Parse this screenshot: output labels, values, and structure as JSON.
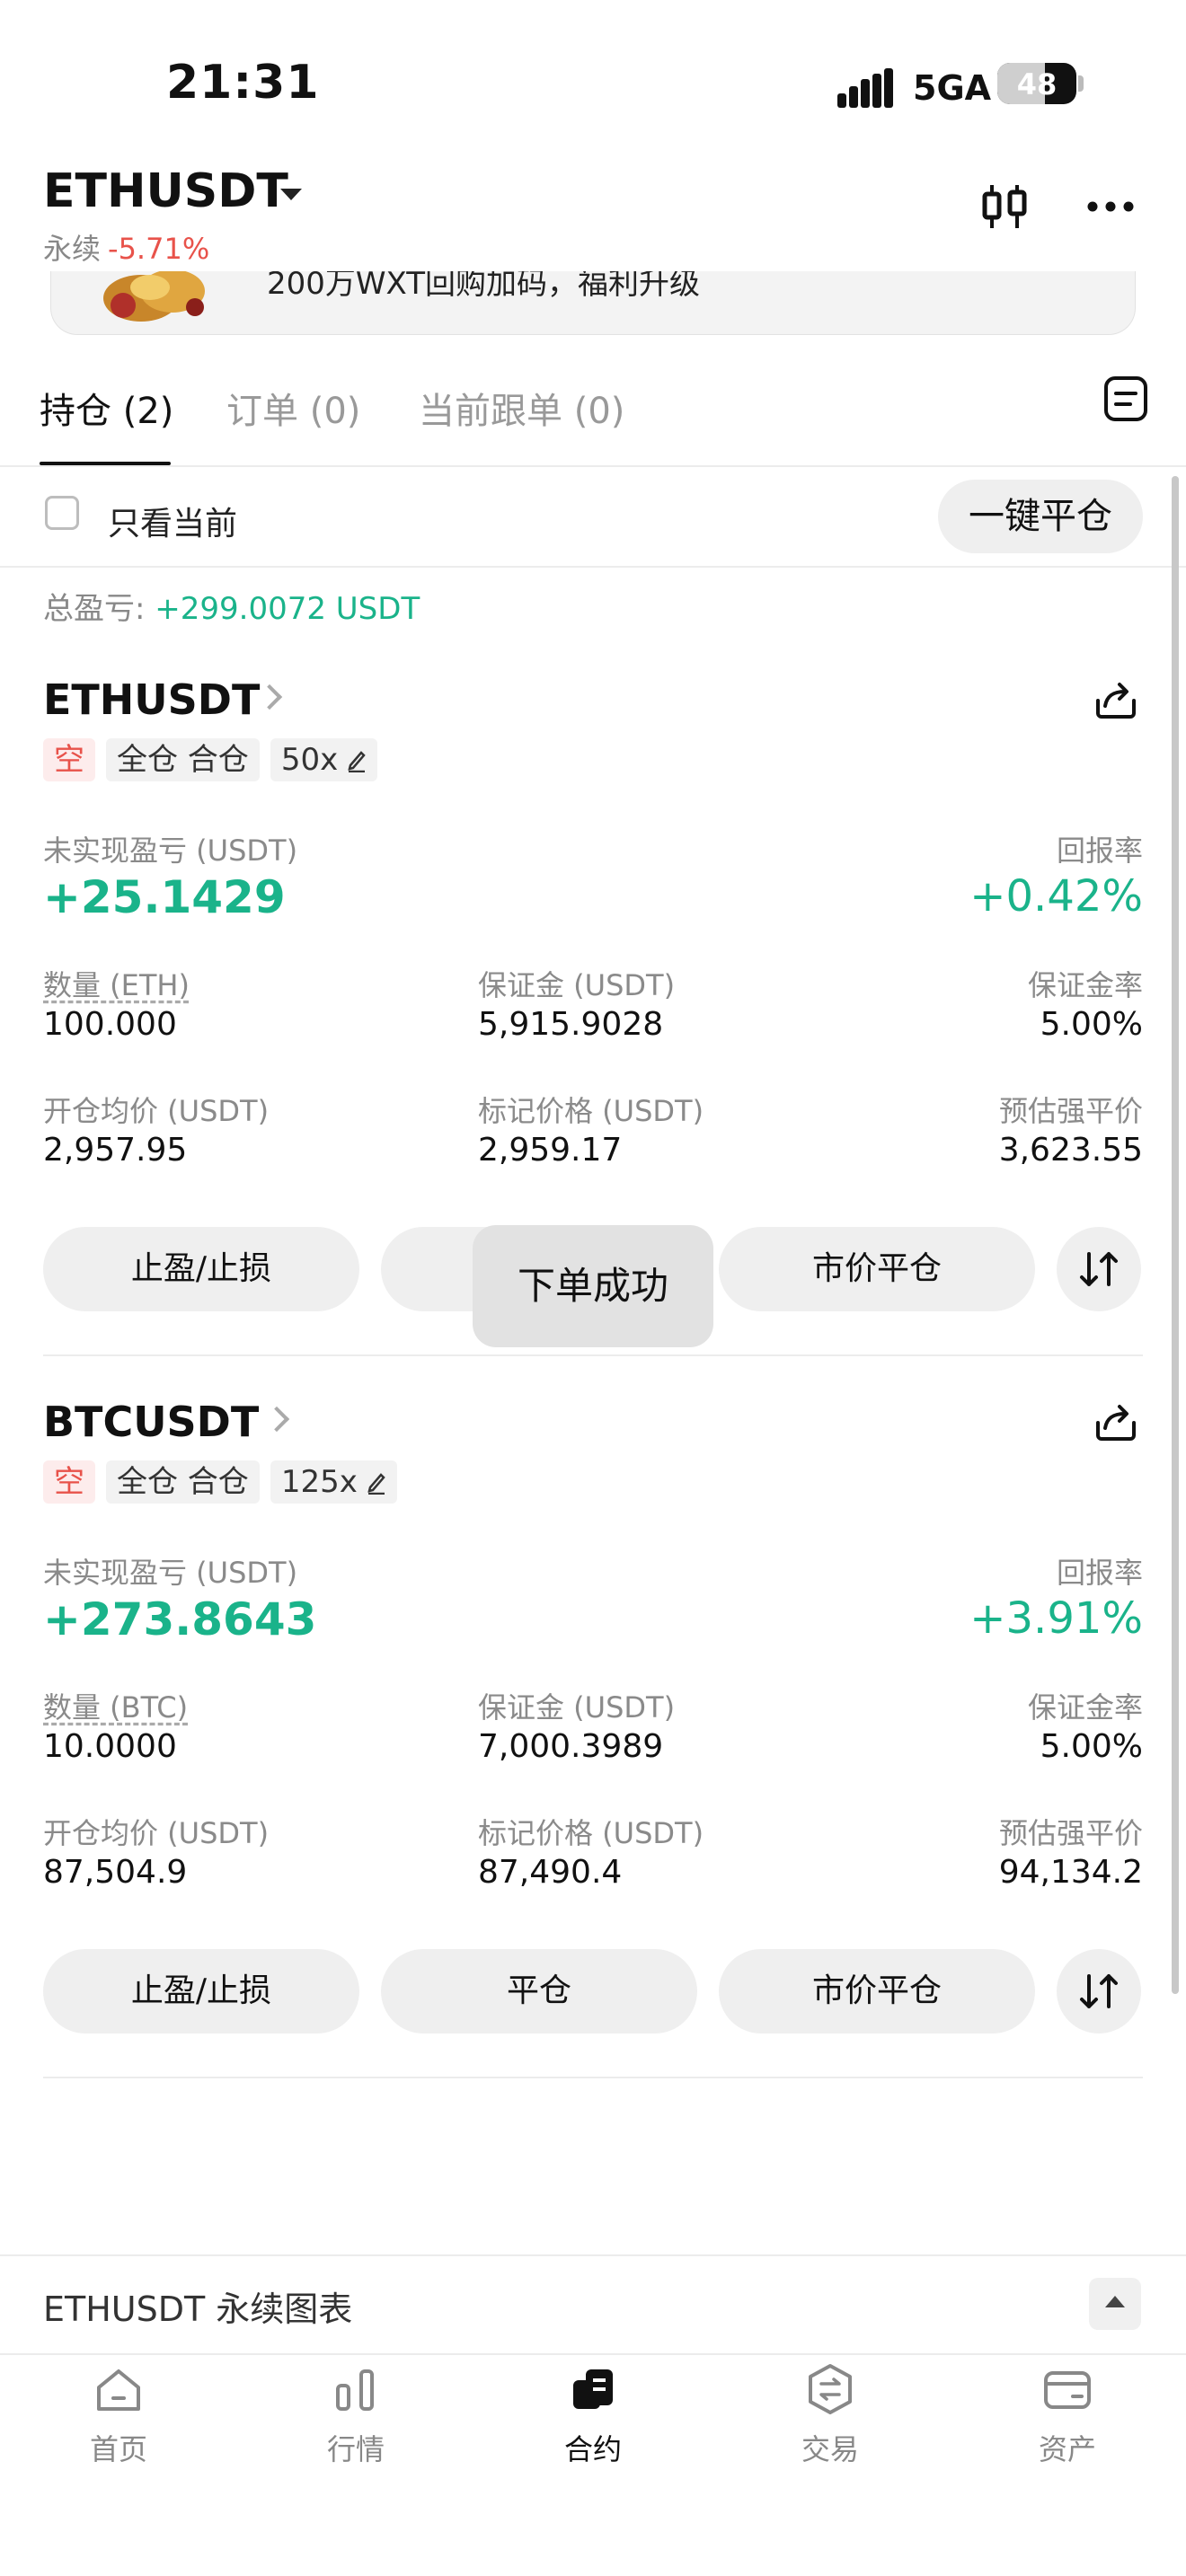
{
  "status_bar": {
    "time": "21:31",
    "network": "5GA",
    "battery": "48"
  },
  "header": {
    "symbol": "ETHUSDT",
    "contract_type": "永续",
    "change": "-5.71%"
  },
  "banner": {
    "text": "200万WXT回购加码，福利升级"
  },
  "tabs": [
    {
      "label": "持仓 (2)",
      "active": true
    },
    {
      "label": "订单 (0)",
      "active": false
    },
    {
      "label": "当前跟单 (0)",
      "active": false
    }
  ],
  "filter": {
    "only_current_label": "只看当前",
    "only_current_checked": false,
    "close_all_label": "一键平仓"
  },
  "summary": {
    "total_pnl_label": "总盈亏: ",
    "total_pnl_value": "+299.0072 USDT"
  },
  "positions": [
    {
      "symbol": "ETHUSDT",
      "side": "空",
      "margin_mode": "全仓 合仓",
      "leverage": "50x",
      "pnl_label": "未实现盈亏 (USDT)",
      "pnl_value": "+25.1429",
      "roe_label": "回报率",
      "roe_value": "+0.42%",
      "qty_label": "数量 (ETH)",
      "qty_value": "100.000",
      "margin_label": "保证金 (USDT)",
      "margin_value": "5,915.9028",
      "margin_ratio_label": "保证金率",
      "margin_ratio_value": "5.00%",
      "entry_label": "开仓均价 (USDT)",
      "entry_value": "2,957.95",
      "mark_label": "标记价格 (USDT)",
      "mark_value": "2,959.17",
      "liq_label": "预估强平价",
      "liq_value": "3,623.55",
      "btn_tpsl": "止盈/止损",
      "btn_close": "平仓",
      "btn_market_close": "市价平仓"
    },
    {
      "symbol": "BTCUSDT",
      "side": "空",
      "margin_mode": "全仓 合仓",
      "leverage": "125x",
      "pnl_label": "未实现盈亏 (USDT)",
      "pnl_value": "+273.8643",
      "roe_label": "回报率",
      "roe_value": "+3.91%",
      "qty_label": "数量 (BTC)",
      "qty_value": "10.0000",
      "margin_label": "保证金 (USDT)",
      "margin_value": "7,000.3989",
      "margin_ratio_label": "保证金率",
      "margin_ratio_value": "5.00%",
      "entry_label": "开仓均价 (USDT)",
      "entry_value": "87,504.9",
      "mark_label": "标记价格 (USDT)",
      "mark_value": "87,490.4",
      "liq_label": "预估强平价",
      "liq_value": "94,134.2",
      "btn_tpsl": "止盈/止损",
      "btn_close": "平仓",
      "btn_market_close": "市价平仓"
    }
  ],
  "toast": {
    "text": "下单成功"
  },
  "chart_bar": {
    "label": "ETHUSDT 永续图表"
  },
  "bottom_nav": [
    {
      "label": "首页",
      "icon": "home-icon",
      "active": false
    },
    {
      "label": "行情",
      "icon": "market-icon",
      "active": false
    },
    {
      "label": "合约",
      "icon": "futures-icon",
      "active": true
    },
    {
      "label": "交易",
      "icon": "trade-icon",
      "active": false
    },
    {
      "label": "资产",
      "icon": "wallet-icon",
      "active": false
    }
  ],
  "colors": {
    "positive": "#1ab38a",
    "negative": "#e8524a",
    "button_bg": "#efefef"
  }
}
